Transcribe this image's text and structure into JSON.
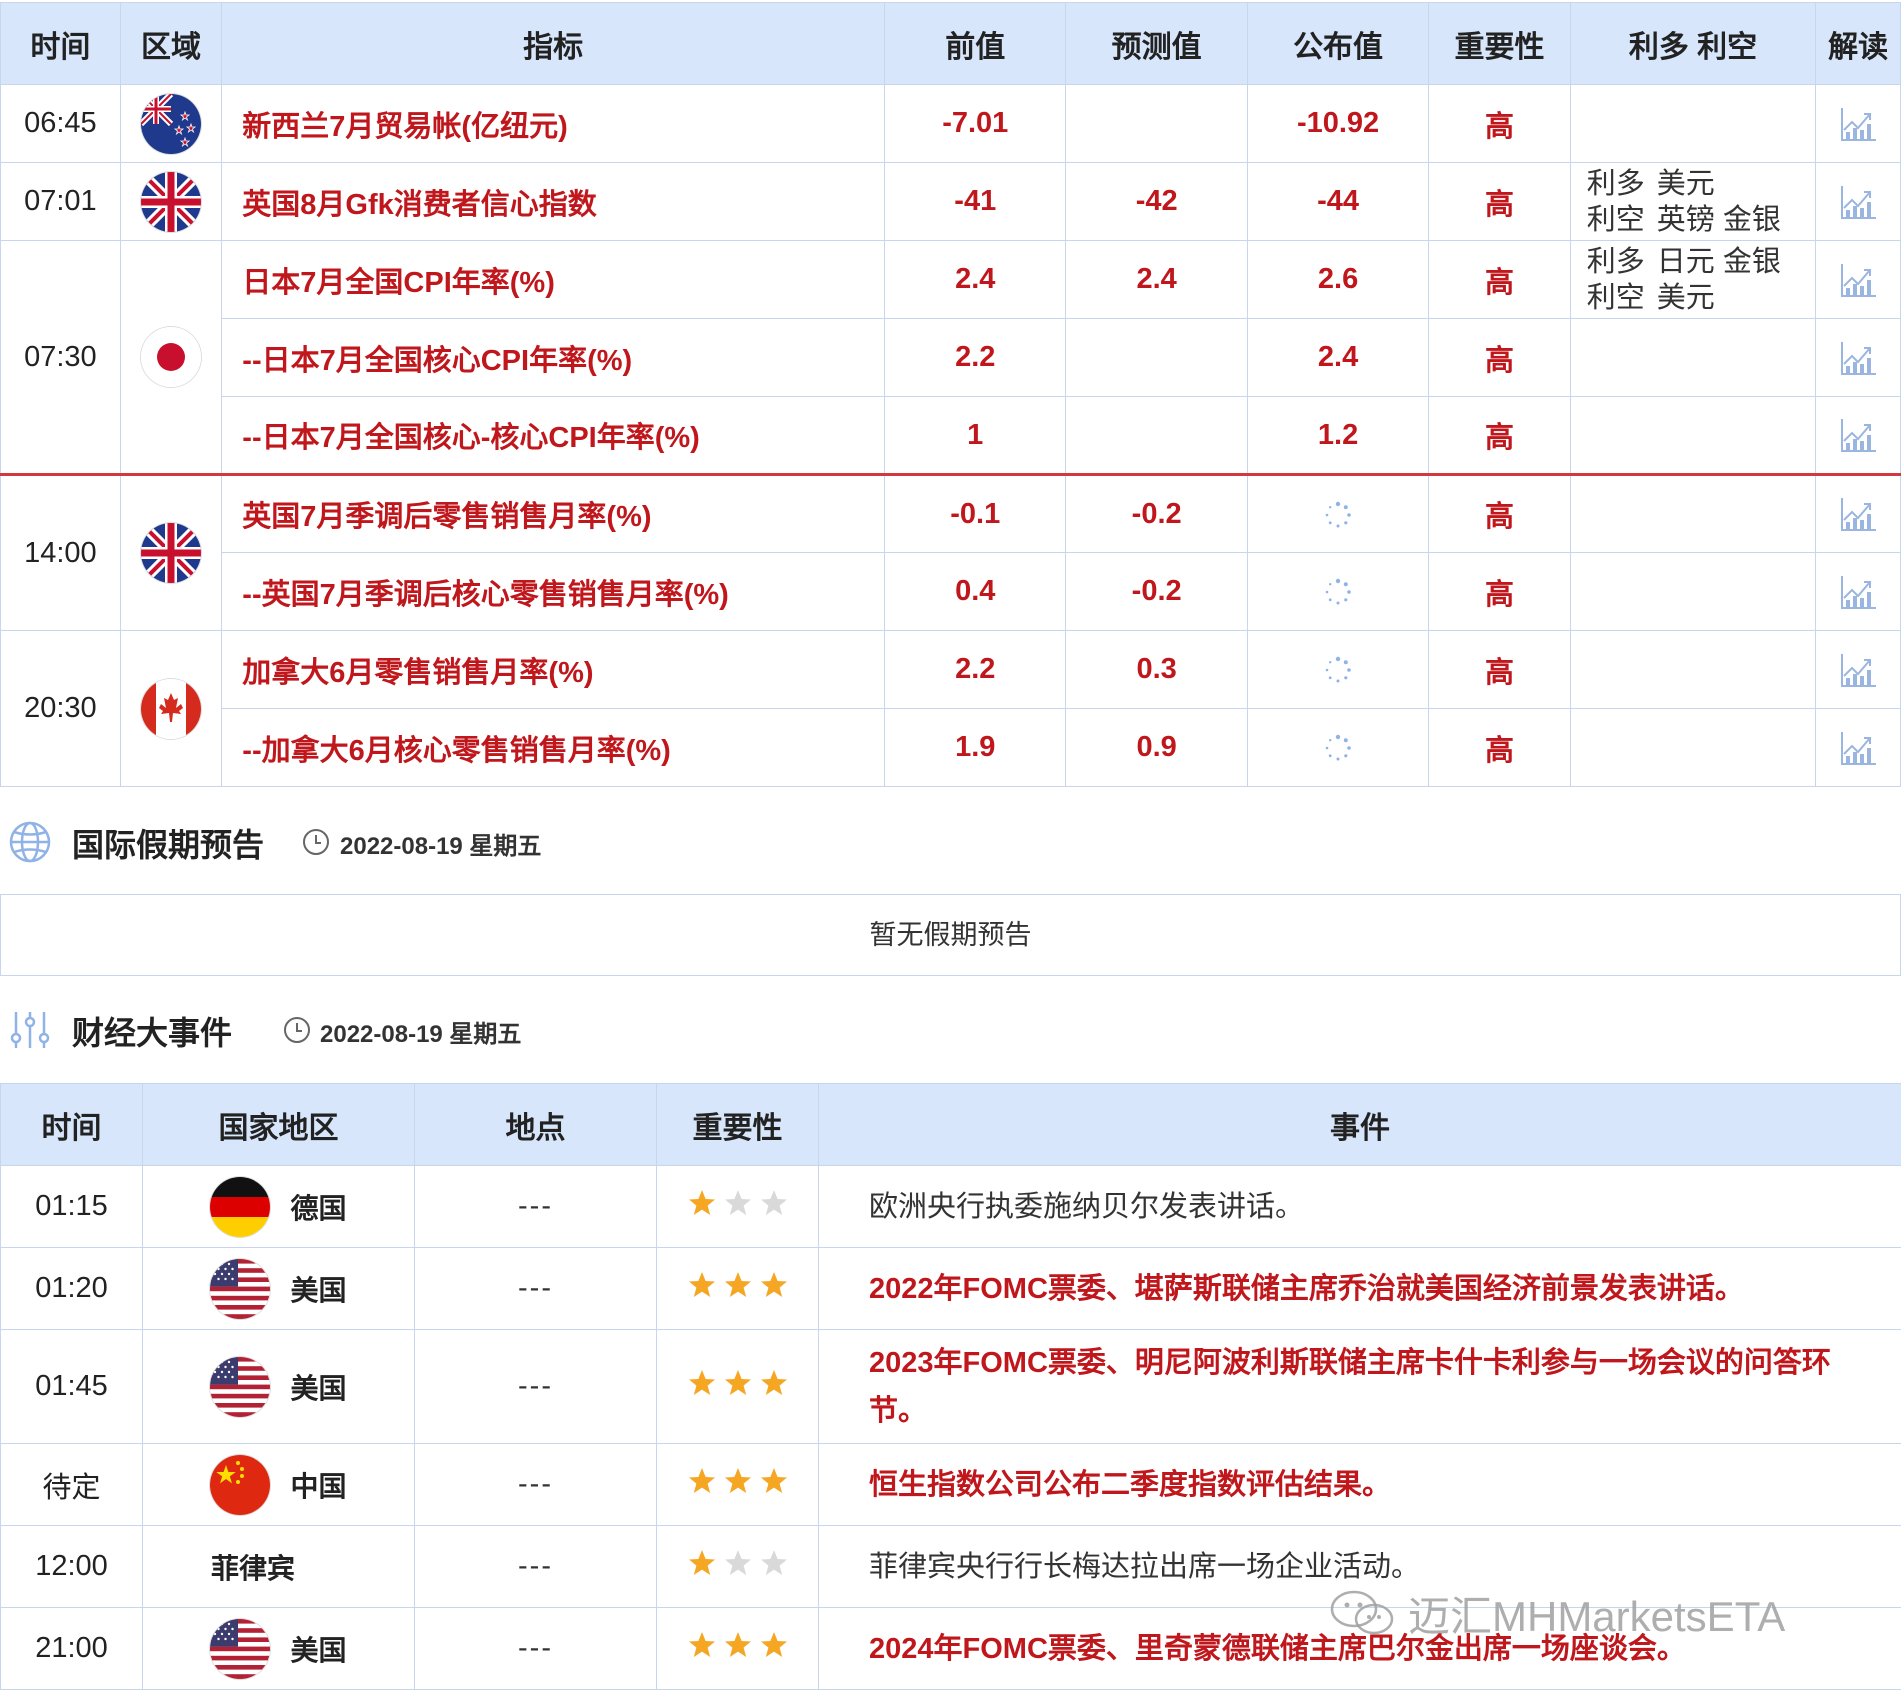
{
  "econ_table": {
    "headers": [
      "时间",
      "区域",
      "指标",
      "前值",
      "预测值",
      "公布值",
      "重要性",
      "利多 利空",
      "解读"
    ],
    "rows": [
      {
        "time": "06:45",
        "flag": "nz-flag",
        "indicator": "新西兰7月贸易帐(亿纽元)",
        "previous": "-7.01",
        "forecast": "",
        "actual": "-10.92",
        "importance": "高",
        "bull_label": "",
        "bull": "",
        "bear_label": "",
        "bear": ""
      },
      {
        "time": "07:01",
        "flag": "uk-flag",
        "indicator": "英国8月Gfk消费者信心指数",
        "previous": "-41",
        "forecast": "-42",
        "actual": "-44",
        "importance": "高",
        "bull_label": "利多",
        "bull": "美元",
        "bear_label": "利空",
        "bear": "英镑 金银"
      },
      {
        "time": "07:30",
        "flag": "jp-flag",
        "indicator": "日本7月全国CPI年率(%)",
        "previous": "2.4",
        "forecast": "2.4",
        "actual": "2.6",
        "importance": "高",
        "bull_label": "利多",
        "bull": "日元 金银",
        "bear_label": "利空",
        "bear": "美元"
      },
      {
        "time": "",
        "flag": "",
        "indicator": "--日本7月全国核心CPI年率(%)",
        "previous": "2.2",
        "forecast": "",
        "actual": "2.4",
        "importance": "高",
        "bull_label": "",
        "bull": "",
        "bear_label": "",
        "bear": ""
      },
      {
        "time": "",
        "flag": "",
        "indicator": "--日本7月全国核心-核心CPI年率(%)",
        "previous": "1",
        "forecast": "",
        "actual": "1.2",
        "importance": "高",
        "bull_label": "",
        "bull": "",
        "bear_label": "",
        "bear": ""
      },
      {
        "time": "14:00",
        "flag": "uk-flag",
        "indicator": "英国7月季调后零售销售月率(%)",
        "previous": "-0.1",
        "forecast": "-0.2",
        "actual": "",
        "importance": "高",
        "bull_label": "",
        "bull": "",
        "bear_label": "",
        "bear": ""
      },
      {
        "time": "",
        "flag": "",
        "indicator": "--英国7月季调后核心零售销售月率(%)",
        "previous": "0.4",
        "forecast": "-0.2",
        "actual": "",
        "importance": "高",
        "bull_label": "",
        "bull": "",
        "bear_label": "",
        "bear": ""
      },
      {
        "time": "20:30",
        "flag": "ca-flag",
        "indicator": "加拿大6月零售销售月率(%)",
        "previous": "2.2",
        "forecast": "0.3",
        "actual": "",
        "importance": "高",
        "bull_label": "",
        "bull": "",
        "bear_label": "",
        "bear": ""
      },
      {
        "time": "",
        "flag": "",
        "indicator": "--加拿大6月核心零售销售月率(%)",
        "previous": "1.9",
        "forecast": "0.9",
        "actual": "",
        "importance": "高",
        "bull_label": "",
        "bull": "",
        "bear_label": "",
        "bear": ""
      }
    ]
  },
  "holiday_section": {
    "title": "国际假期预告",
    "date": "2022-08-19 星期五",
    "empty_text": "暂无假期预告"
  },
  "events_section": {
    "title": "财经大事件",
    "date": "2022-08-19 星期五",
    "headers": [
      "时间",
      "国家地区",
      "地点",
      "重要性",
      "事件"
    ],
    "rows": [
      {
        "time": "01:15",
        "flag": "de-flag",
        "country": "德国",
        "place": "---",
        "stars": 1,
        "event": "欧洲央行执委施纳贝尔发表讲话。",
        "highlight": false
      },
      {
        "time": "01:20",
        "flag": "us-flag",
        "country": "美国",
        "place": "---",
        "stars": 3,
        "event": "2022年FOMC票委、堪萨斯联储主席乔治就美国经济前景发表讲话。",
        "highlight": true
      },
      {
        "time": "01:45",
        "flag": "us-flag",
        "country": "美国",
        "place": "---",
        "stars": 3,
        "event": "2023年FOMC票委、明尼阿波利斯联储主席卡什卡利参与一场会议的问答环节。",
        "highlight": true
      },
      {
        "time": "待定",
        "flag": "cn-flag",
        "country": "中国",
        "place": "---",
        "stars": 3,
        "event": "恒生指数公司公布二季度指数评估结果。",
        "highlight": true
      },
      {
        "time": "12:00",
        "flag": "",
        "country": "菲律宾",
        "place": "---",
        "stars": 1,
        "event": "菲律宾央行行长梅达拉出席一场企业活动。",
        "highlight": false
      },
      {
        "time": "21:00",
        "flag": "us-flag",
        "country": "美国",
        "place": "---",
        "stars": 3,
        "event": "2024年FOMC票委、里奇蒙德联储主席巴尔金出席一场座谈会。",
        "highlight": true
      }
    ]
  },
  "watermark": {
    "text": "迈汇MHMarketsETA",
    "icon": "wechat-icon"
  },
  "colors": {
    "accent_red": "#c0171c",
    "header_bg": "#d7e6fb",
    "border": "#c7d6ec",
    "star_on": "#f5a623",
    "star_off": "#d9d9d9",
    "separator": "#d0393e"
  }
}
